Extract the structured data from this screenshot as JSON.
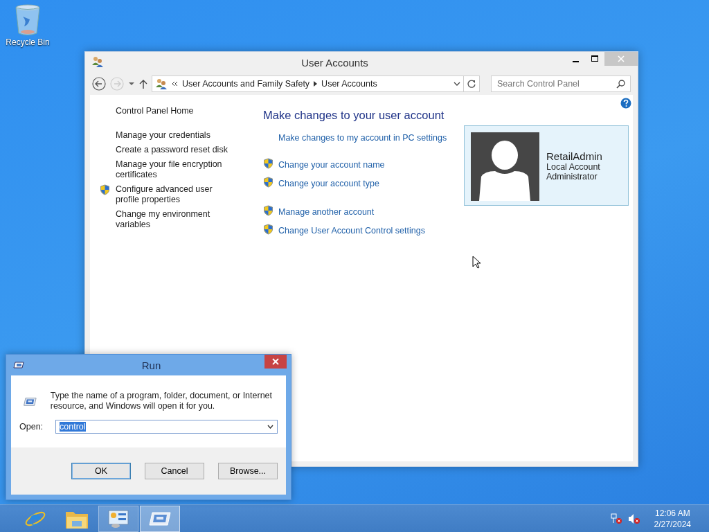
{
  "desktop_icons": [
    {
      "label": "Recycle Bin"
    }
  ],
  "control_panel": {
    "title": "User Accounts",
    "breadcrumb": [
      "User Accounts and Family Safety",
      "User Accounts"
    ],
    "search": {
      "placeholder": "Search Control Panel"
    },
    "sidebar_groups": [
      [
        {
          "label": "Control Panel Home",
          "shield": false
        }
      ],
      [
        {
          "label": "Manage your credentials",
          "shield": false
        },
        {
          "label": "Create a password reset disk",
          "shield": false
        },
        {
          "label": "Manage your file encryption certificates",
          "shield": false
        },
        {
          "label": "Configure advanced user profile properties",
          "shield": true
        },
        {
          "label": "Change my environment variables",
          "shield": false
        }
      ]
    ],
    "heading": "Make changes to your user account",
    "link_groups": [
      [
        {
          "label": "Make changes to my account in PC settings",
          "shield": false
        }
      ],
      [
        {
          "label": "Change your account name",
          "shield": true
        },
        {
          "label": "Change your account type",
          "shield": true
        }
      ],
      [
        {
          "label": "Manage another account",
          "shield": true
        },
        {
          "label": "Change User Account Control settings",
          "shield": true
        }
      ]
    ],
    "account": {
      "name": "RetailAdmin",
      "type": "Local Account",
      "role": "Administrator"
    }
  },
  "run_dialog": {
    "title": "Run",
    "description": "Type the name of a program, folder, document, or Internet resource, and Windows will open it for you.",
    "open_label": "Open:",
    "value": "control",
    "buttons": [
      {
        "label": "OK",
        "default": true
      },
      {
        "label": "Cancel",
        "default": false
      },
      {
        "label": "Browse...",
        "default": false
      }
    ]
  },
  "taskbar": {
    "apps": [
      {
        "kind": "browser",
        "open": false,
        "selected": false
      },
      {
        "kind": "folder",
        "open": false,
        "selected": false
      },
      {
        "kind": "control-panel",
        "open": true,
        "selected": false
      },
      {
        "kind": "run",
        "open": true,
        "selected": true
      }
    ],
    "time": "12:06 AM",
    "date": "2/27/2024"
  }
}
